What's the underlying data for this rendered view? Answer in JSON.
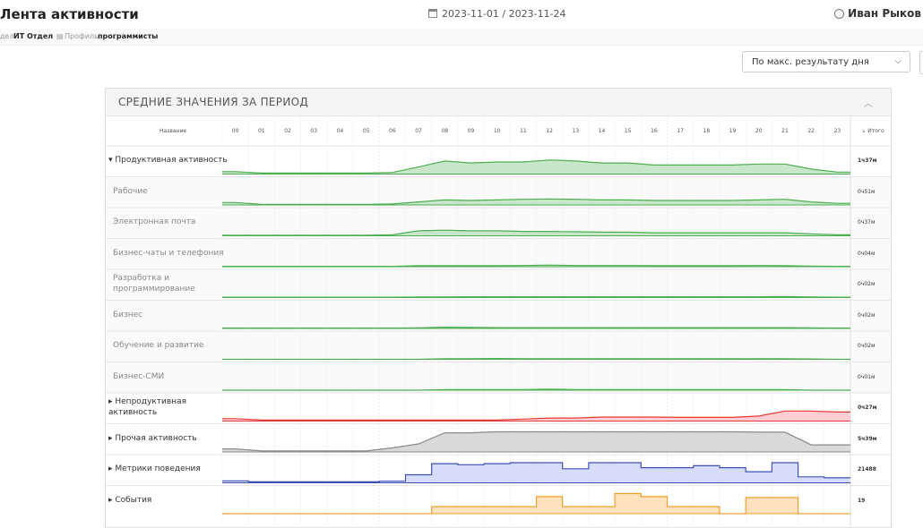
{
  "header": {
    "title": "Лента активности",
    "date_range": "2023-11-01 / 2023-11-24",
    "user_name": "Иван Рыков"
  },
  "breadcrumb": {
    "dept_prefix": "дел",
    "dept_value": "ИТ Отдел",
    "profile_label": "Профиль",
    "profile_value": "программисты"
  },
  "toolbar": {
    "sort_value": "По макс. результату дня"
  },
  "panel": {
    "title": "СРЕДНИЕ ЗНАЧЕНИЯ ЗА ПЕРИОД",
    "name_header": "Название",
    "total_header": "Итого"
  },
  "colors": {
    "green": "#4caf50",
    "red": "#e53935",
    "gray": "#8a8a8a",
    "blue": "#3f51b5",
    "orange": "#f0a030"
  },
  "chart_data": {
    "type": "area",
    "x": [
      "00",
      "01",
      "02",
      "03",
      "04",
      "05",
      "06",
      "07",
      "08",
      "09",
      "10",
      "11",
      "12",
      "13",
      "14",
      "15",
      "16",
      "17",
      "18",
      "19",
      "20",
      "21",
      "22",
      "23"
    ],
    "rows": [
      {
        "name": "▾ Продуктивная активность",
        "total": "1ч37м",
        "level": "top",
        "color": "green",
        "step": false,
        "values": [
          0.12,
          0.05,
          0.05,
          0.05,
          0.05,
          0.05,
          0.08,
          0.35,
          0.65,
          0.55,
          0.6,
          0.6,
          0.7,
          0.65,
          0.55,
          0.55,
          0.45,
          0.45,
          0.45,
          0.45,
          0.5,
          0.5,
          0.25,
          0.1
        ]
      },
      {
        "name": "Рабочие",
        "total": "0ч51м",
        "level": "sub",
        "color": "green",
        "step": false,
        "values": [
          0.12,
          0.03,
          0.03,
          0.03,
          0.03,
          0.03,
          0.05,
          0.15,
          0.25,
          0.22,
          0.25,
          0.28,
          0.3,
          0.28,
          0.25,
          0.25,
          0.22,
          0.22,
          0.22,
          0.22,
          0.25,
          0.28,
          0.15,
          0.08
        ]
      },
      {
        "name": "Электронная почта",
        "total": "0ч37м",
        "level": "sub",
        "color": "green",
        "step": false,
        "values": [
          0.03,
          0.03,
          0.03,
          0.03,
          0.03,
          0.03,
          0.05,
          0.25,
          0.28,
          0.25,
          0.25,
          0.22,
          0.22,
          0.2,
          0.18,
          0.18,
          0.15,
          0.15,
          0.15,
          0.15,
          0.15,
          0.15,
          0.1,
          0.05
        ]
      },
      {
        "name": "Бизнес-чаты и телефония",
        "total": "0ч04м",
        "level": "sub",
        "color": "green",
        "step": false,
        "values": [
          0.02,
          0.02,
          0.02,
          0.02,
          0.02,
          0.02,
          0.02,
          0.05,
          0.05,
          0.05,
          0.05,
          0.06,
          0.08,
          0.06,
          0.06,
          0.06,
          0.05,
          0.05,
          0.05,
          0.05,
          0.06,
          0.05,
          0.03,
          0.02
        ]
      },
      {
        "name": "Разработка и\nпрограммирование",
        "total": "0ч02м",
        "level": "sub",
        "color": "green",
        "step": false,
        "values": [
          0.02,
          0.02,
          0.02,
          0.02,
          0.02,
          0.02,
          0.02,
          0.03,
          0.03,
          0.04,
          0.04,
          0.04,
          0.04,
          0.04,
          0.04,
          0.04,
          0.04,
          0.04,
          0.04,
          0.04,
          0.04,
          0.05,
          0.03,
          0.02
        ]
      },
      {
        "name": "Бизнес",
        "total": "0ч02м",
        "level": "sub",
        "color": "green",
        "step": false,
        "values": [
          0.02,
          0.02,
          0.02,
          0.02,
          0.02,
          0.02,
          0.02,
          0.03,
          0.06,
          0.05,
          0.04,
          0.04,
          0.04,
          0.04,
          0.04,
          0.04,
          0.04,
          0.04,
          0.04,
          0.04,
          0.04,
          0.04,
          0.03,
          0.02
        ]
      },
      {
        "name": "Обучение и развитие",
        "total": "0ч02м",
        "level": "sub",
        "color": "green",
        "step": false,
        "values": [
          0.0,
          0.0,
          0.0,
          0.0,
          0.0,
          0.0,
          0.0,
          0.0,
          0.03,
          0.03,
          0.04,
          0.03,
          0.03,
          0.03,
          0.03,
          0.03,
          0.03,
          0.03,
          0.03,
          0.03,
          0.03,
          0.03,
          0.02,
          0.0
        ]
      },
      {
        "name": "Бизнес-СМИ",
        "total": "0ч01м",
        "level": "sub",
        "color": "green",
        "step": false,
        "values": [
          0.0,
          0.0,
          0.0,
          0.0,
          0.0,
          0.0,
          0.0,
          0.0,
          0.03,
          0.03,
          0.03,
          0.03,
          0.05,
          0.03,
          0.03,
          0.03,
          0.03,
          0.03,
          0.03,
          0.03,
          0.03,
          0.03,
          0.0,
          0.0
        ]
      },
      {
        "name": "▸ Непродуктивная\nактивность",
        "total": "0ч27м",
        "level": "top",
        "color": "red",
        "step": false,
        "values": [
          0.12,
          0.05,
          0.05,
          0.05,
          0.05,
          0.05,
          0.05,
          0.05,
          0.05,
          0.05,
          0.05,
          0.1,
          0.15,
          0.15,
          0.2,
          0.2,
          0.2,
          0.18,
          0.18,
          0.18,
          0.25,
          0.5,
          0.5,
          0.45
        ]
      },
      {
        "name": "▸ Прочая активность",
        "total": "5ч39м",
        "level": "top",
        "color": "gray",
        "step": false,
        "values": [
          0.15,
          0.05,
          0.05,
          0.05,
          0.05,
          0.05,
          0.2,
          0.4,
          0.95,
          0.95,
          1.0,
          1.0,
          1.0,
          1.0,
          1.0,
          1.0,
          1.0,
          1.0,
          1.0,
          1.0,
          0.98,
          0.98,
          0.35,
          0.35
        ]
      },
      {
        "name": "▸ Метрики поведения",
        "total": "21488",
        "level": "top",
        "color": "blue",
        "step": true,
        "values": [
          0.1,
          0.05,
          0.05,
          0.05,
          0.05,
          0.05,
          0.08,
          0.4,
          0.95,
          0.9,
          0.95,
          1.0,
          1.0,
          0.7,
          1.0,
          1.0,
          0.75,
          0.75,
          0.85,
          0.75,
          0.55,
          1.0,
          0.3,
          0.25
        ]
      },
      {
        "name": "▸ События",
        "total": "19",
        "level": "top",
        "color": "orange",
        "step": true,
        "values": [
          0.0,
          0.0,
          0.0,
          0.0,
          0.0,
          0.0,
          0.0,
          0.0,
          0.35,
          0.35,
          0.35,
          0.35,
          0.85,
          0.35,
          0.35,
          1.0,
          0.85,
          0.35,
          0.35,
          0.0,
          0.8,
          0.8,
          0.0,
          0.0
        ]
      }
    ]
  }
}
